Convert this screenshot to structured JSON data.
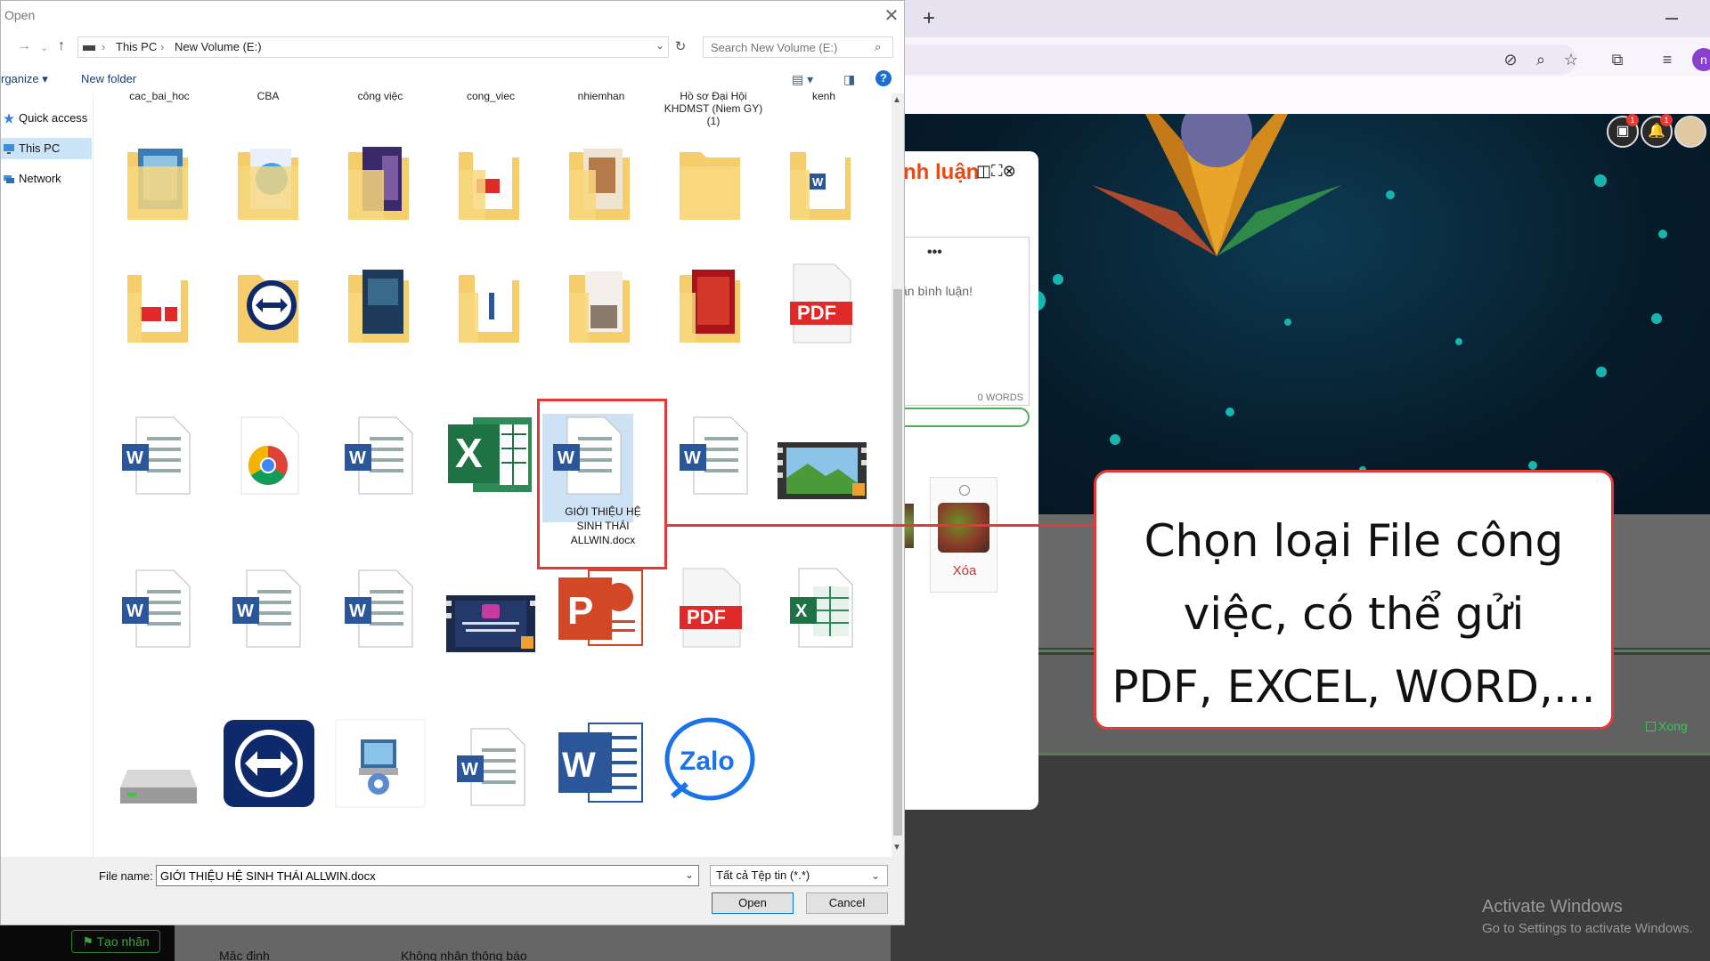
{
  "dialog": {
    "title": "Open",
    "close_icon": "close-icon",
    "address": {
      "crumbs": [
        "This PC",
        "New Volume (E:)"
      ]
    },
    "search_placeholder": "Search New Volume (E:)",
    "toolbar": {
      "organize": "rganize ▾",
      "new_folder": "New folder"
    },
    "nav": [
      {
        "label": "Quick access",
        "icon": "star-icon"
      },
      {
        "label": "This PC",
        "icon": "computer-icon",
        "selected": true
      },
      {
        "label": "Network",
        "icon": "network-icon"
      }
    ],
    "top_labels": [
      "cac_bai_hoc",
      "CBA",
      "công việc",
      "cong_viec",
      "nhiemhan",
      "Hồ sơ Đại Hội KHDMST (Niem GY) (1)",
      "kenh"
    ],
    "selected_file_label": "GIỚI THIỆU HỆ SINH THÁI ALLWIN.docx",
    "footer": {
      "file_name_label": "File name:",
      "file_name_value": "GIỚI THIỆU HỆ SINH THÁI ALLWIN.docx",
      "file_type": "Tất cả Tệp tin (*.*)",
      "open": "Open",
      "cancel": "Cancel"
    }
  },
  "comment_panel": {
    "title": "nh luận",
    "placeholder": "ần bình luận!",
    "words": "0 WORDS",
    "delete": "Xóa"
  },
  "page": {
    "done": "Xong",
    "tao_nhan": "Tạo nhãn",
    "mac_dinh": "Mặc định",
    "khong_nhan": "Không nhận thông báo",
    "badge_count": "1"
  },
  "watermark": {
    "line1": "Activate Windows",
    "line2": "Go to Settings to activate Windows."
  },
  "callout": {
    "lines": [
      "Chọn loại File công",
      "việc, có thể gửi",
      "PDF, EXCEL, WORD,..."
    ]
  },
  "colors": {
    "accent_red": "#e53935",
    "title_orange": "#e64a19",
    "word_blue": "#2b579a",
    "excel_green": "#1f7244",
    "pdf_red": "#e02a2a"
  }
}
